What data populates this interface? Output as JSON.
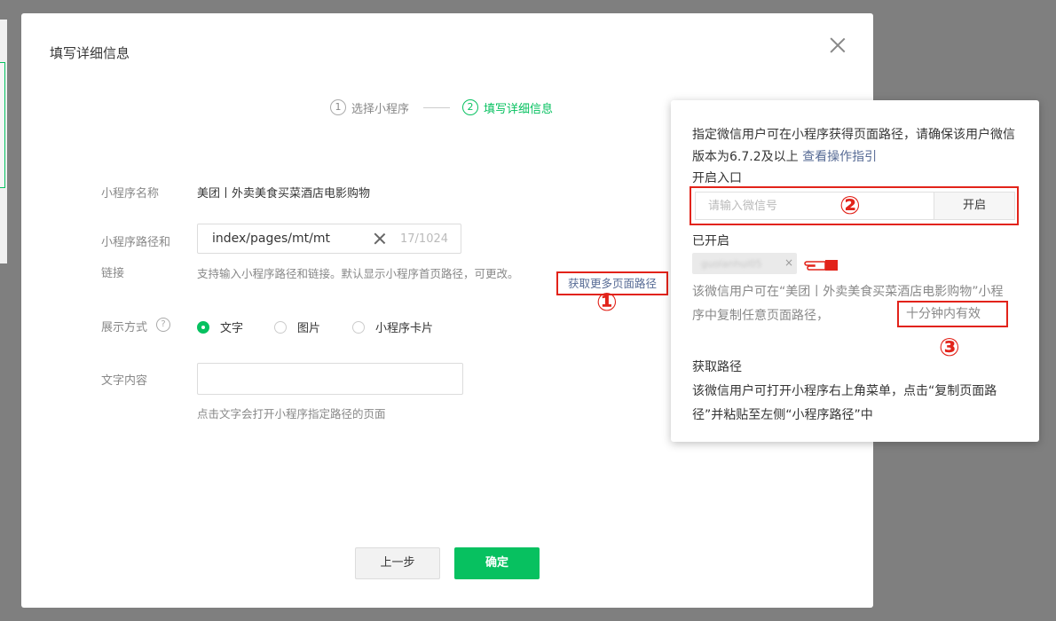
{
  "modal": {
    "title": "填写详细信息",
    "steps": [
      {
        "num": "1",
        "label": "选择小程序"
      },
      {
        "num": "2",
        "label": "填写详细信息"
      }
    ]
  },
  "form": {
    "app_name_label": "小程序名称",
    "app_name_value": "美团丨外卖美食买菜酒店电影购物",
    "path_label_line1": "小程序路径和",
    "path_label_line2": "链接",
    "path_value": "index/pages/mt/mt",
    "path_counter": "17/1024",
    "path_hint": "支持输入小程序路径和链接。默认显示小程序首页路径，可更改。",
    "more_paths_link": "获取更多页面路径",
    "display_label": "展示方式",
    "help_glyph": "?",
    "display_options": [
      "文字",
      "图片",
      "小程序卡片"
    ],
    "display_selected": "文字",
    "text_content_label": "文字内容",
    "text_content_value": "",
    "text_hint": "点击文字会打开小程序指定路径的页面"
  },
  "buttons": {
    "prev": "上一步",
    "confirm": "确定"
  },
  "popover": {
    "desc": "指定微信用户可在小程序获得页面路径，请确保该用户微信版本为6.7.2及以上",
    "guide_link": "查看操作指引",
    "entry_title": "开启入口",
    "wx_placeholder": "请输入微信号",
    "open_button": "开启",
    "opened_title": "已开启",
    "opened_user": "guolanhui05",
    "opened_desc": "该微信用户可在“美团丨外卖美食买菜酒店电影购物”小程序中复制任意页面路径，",
    "valid_text": "十分钟内有效",
    "get_path_title": "获取路径",
    "get_path_desc": "该微信用户可打开小程序右上角菜单，点击“复制页面路径”并粘贴至左侧“小程序路径”中"
  },
  "annotations": {
    "one": "①",
    "two": "②",
    "three": "③"
  },
  "colors": {
    "accent": "#07c160",
    "link": "#576b95",
    "annotation": "#e2231a"
  }
}
